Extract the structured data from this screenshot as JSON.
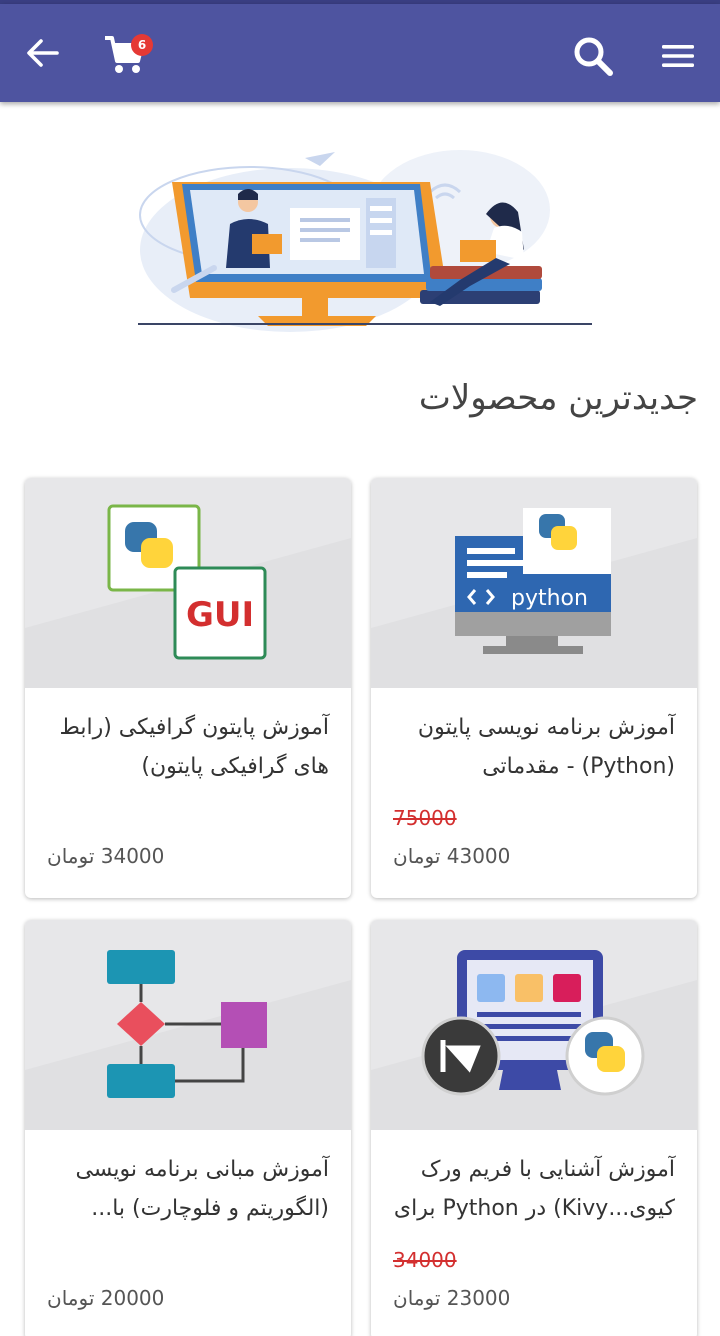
{
  "app_bar": {
    "back_icon": "arrow-back-icon",
    "cart_icon": "shopping-cart-icon",
    "cart_count": "6",
    "search_icon": "search-icon",
    "menu_icon": "hamburger-menu-icon",
    "background_color": "#4e54a0"
  },
  "hero": {
    "illustration": "online-learning-illustration"
  },
  "section": {
    "title": "جدیدترین محصولات"
  },
  "products": [
    {
      "title_line1": "آموزش برنامه نویسی پایتون",
      "title_line2": "(Python) - مقدماتی",
      "old_price": "75000",
      "price": "43000 تومان",
      "thumbnail": "python-monitor-thumbnail"
    },
    {
      "title_line1": "آموزش پایتون گرافیکی (رابط",
      "title_line2": "های گرافیکی پایتون)",
      "old_price": "",
      "price": "34000 تومان",
      "thumbnail": "python-gui-thumbnail",
      "gui_text": "GUI"
    },
    {
      "title_line1": "آموزش آشنایی با فریم ورک",
      "title_line2": "کیوی...Kivy) در Python برای",
      "old_price": "34000",
      "price": "23000 تومان",
      "thumbnail": "kivy-python-thumbnail"
    },
    {
      "title_line1": "آموزش مبانی برنامه نویسی",
      "title_line2": "(الگوریتم و فلوچارت) با...",
      "old_price": "",
      "price": "20000 تومان",
      "thumbnail": "flowchart-thumbnail"
    }
  ],
  "colors": {
    "old_price": "#d32f2f",
    "accent": "#4e54a0",
    "badge": "#e53935"
  }
}
